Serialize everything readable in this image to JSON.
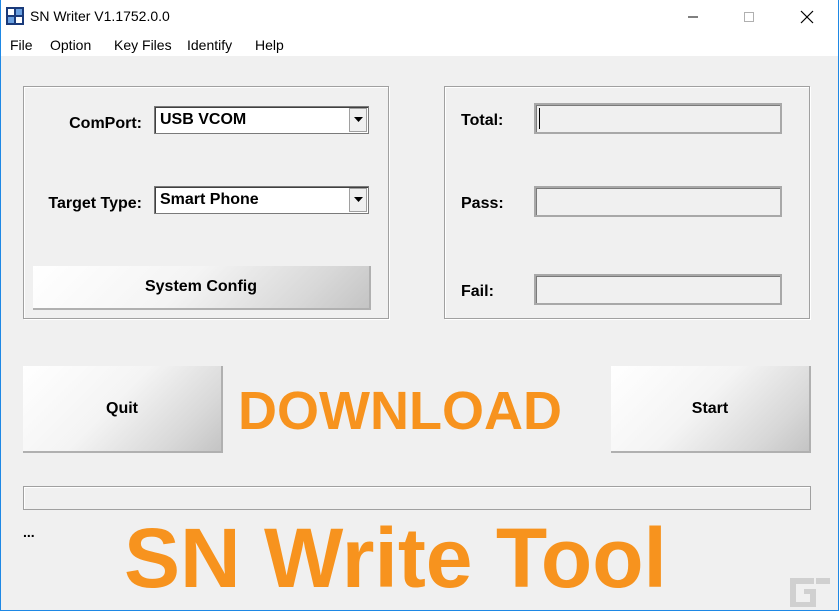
{
  "window": {
    "title": "SN Writer V1.1752.0.0"
  },
  "menu": [
    "File",
    "Option",
    "Key Files",
    "Identify",
    "Help"
  ],
  "config": {
    "comport_label": "ComPort:",
    "comport_value": "USB VCOM",
    "target_type_label": "Target Type:",
    "target_type_value": "Smart Phone",
    "system_config_label": "System Config"
  },
  "stats": {
    "total_label": "Total:",
    "total_value": "",
    "pass_label": "Pass:",
    "pass_value": "",
    "fail_label": "Fail:",
    "fail_value": ""
  },
  "actions": {
    "quit_label": "Quit",
    "start_label": "Start"
  },
  "status_text": "...",
  "overlay": {
    "download": "DOWNLOAD",
    "tool_title": "SN Write Tool",
    "color": "#f7931e"
  },
  "icons": {
    "app": "sn-writer-app-icon",
    "minimize": "minimize-icon",
    "maximize": "maximize-icon",
    "close": "close-icon",
    "dropdown": "chevron-down-icon",
    "watermark": "g-logo-watermark"
  }
}
